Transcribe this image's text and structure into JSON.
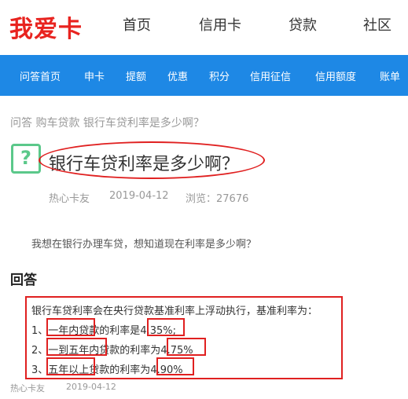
{
  "header": {
    "logo": "我爱卡",
    "nav": [
      "首页",
      "信用卡",
      "贷款",
      "社区"
    ]
  },
  "subnav": [
    "问答首页",
    "申卡",
    "提额",
    "优惠",
    "积分",
    "信用征信",
    "信用额度",
    "账单"
  ],
  "breadcrumb": "问答 购车贷款 银行车贷利率是多少啊？",
  "question": {
    "icon": "?",
    "title": "银行车贷利率是多少啊？",
    "author": "热心卡友",
    "date": "2019-04-12",
    "views": "浏览：27676",
    "body": "我想在银行办理车贷，想知道现在利率是多少啊？"
  },
  "answer": {
    "heading": "回答",
    "intro": "银行车贷利率会在央行贷款基准利率上浮动执行，基准利率为：",
    "lines": [
      {
        "prefix": "1、",
        "term": "一年内",
        "text": "贷款的利率是",
        "rate": "4.35%",
        "suffix": ";"
      },
      {
        "prefix": "2、",
        "term": "一到五年内",
        "text": "贷款的利率为",
        "rate": "4.75%",
        "suffix": ""
      },
      {
        "prefix": "3、",
        "term": "五年以上",
        "text": "贷款的利率为",
        "rate": "4.90%",
        "suffix": ""
      }
    ],
    "author": "热心卡友",
    "date": "2019-04-12"
  },
  "colors": {
    "brand_red": "#e8231f",
    "nav_blue": "#1e88e5",
    "annotation_red": "#e02020",
    "question_icon_green": "#5bc88a"
  }
}
